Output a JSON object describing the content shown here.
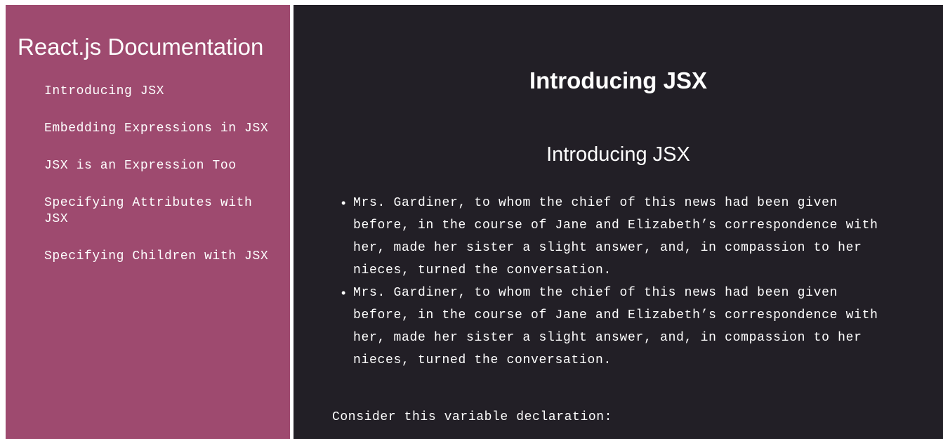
{
  "sidebar": {
    "title": "React.js Documentation",
    "items": [
      {
        "label": "Introducing JSX"
      },
      {
        "label": "Embedding Expressions in JSX"
      },
      {
        "label": "JSX is an Expression Too"
      },
      {
        "label": "Specifying Attributes with JSX"
      },
      {
        "label": "Specifying Children with JSX"
      }
    ]
  },
  "main": {
    "title": "Introducing JSX",
    "section": {
      "title": "Introducing JSX",
      "bullets": [
        "Mrs. Gardiner, to whom the chief of this news had been given before, in the course of Jane and Elizabeth’s correspondence with her, made her sister a slight answer, and, in compassion to her nieces, turned the conversation.",
        "Mrs. Gardiner, to whom the chief of this news had been given before, in the course of Jane and Elizabeth’s correspondence with her, made her sister a slight answer, and, in compassion to her nieces, turned the conversation."
      ],
      "paragraph": "Consider this variable declaration:"
    }
  },
  "colors": {
    "sidebar_background": "#9e4a6f",
    "main_background": "#221f26",
    "text": "#ffffff"
  }
}
